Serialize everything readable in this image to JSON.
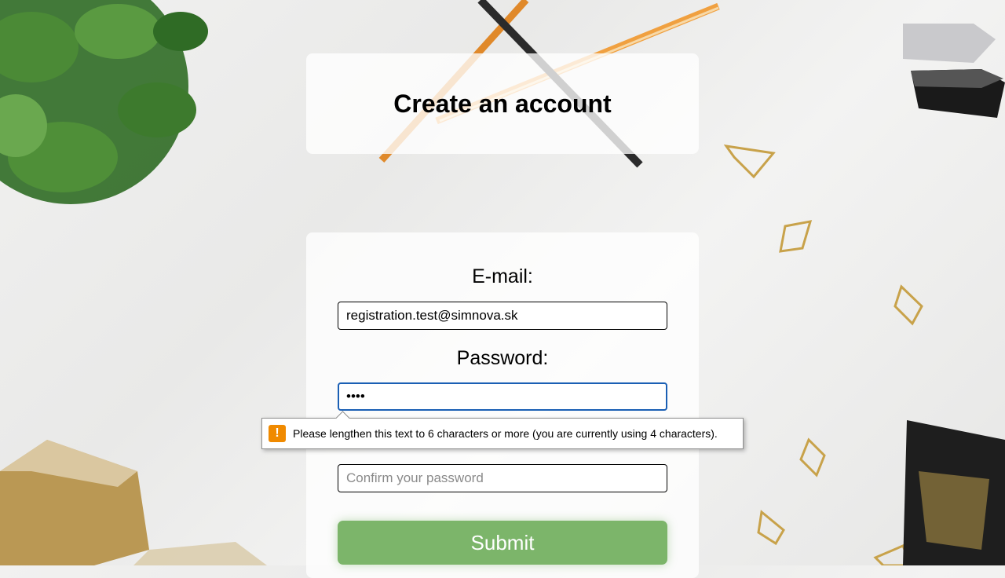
{
  "page": {
    "title": "Create an account"
  },
  "form": {
    "email_label": "E-mail:",
    "email_value": "registration.test@simnova.sk",
    "password_label": "Password:",
    "password_value": "••••",
    "confirm_placeholder": "Confirm your password",
    "submit_label": "Submit"
  },
  "validation_tooltip": {
    "icon": "warning-icon",
    "message": "Please lengthen this text to 6 characters or more (you are currently using 4 characters)."
  },
  "colors": {
    "submit": "#7cb56a",
    "focus_border": "#1a5fb4",
    "warning": "#f08a00"
  }
}
